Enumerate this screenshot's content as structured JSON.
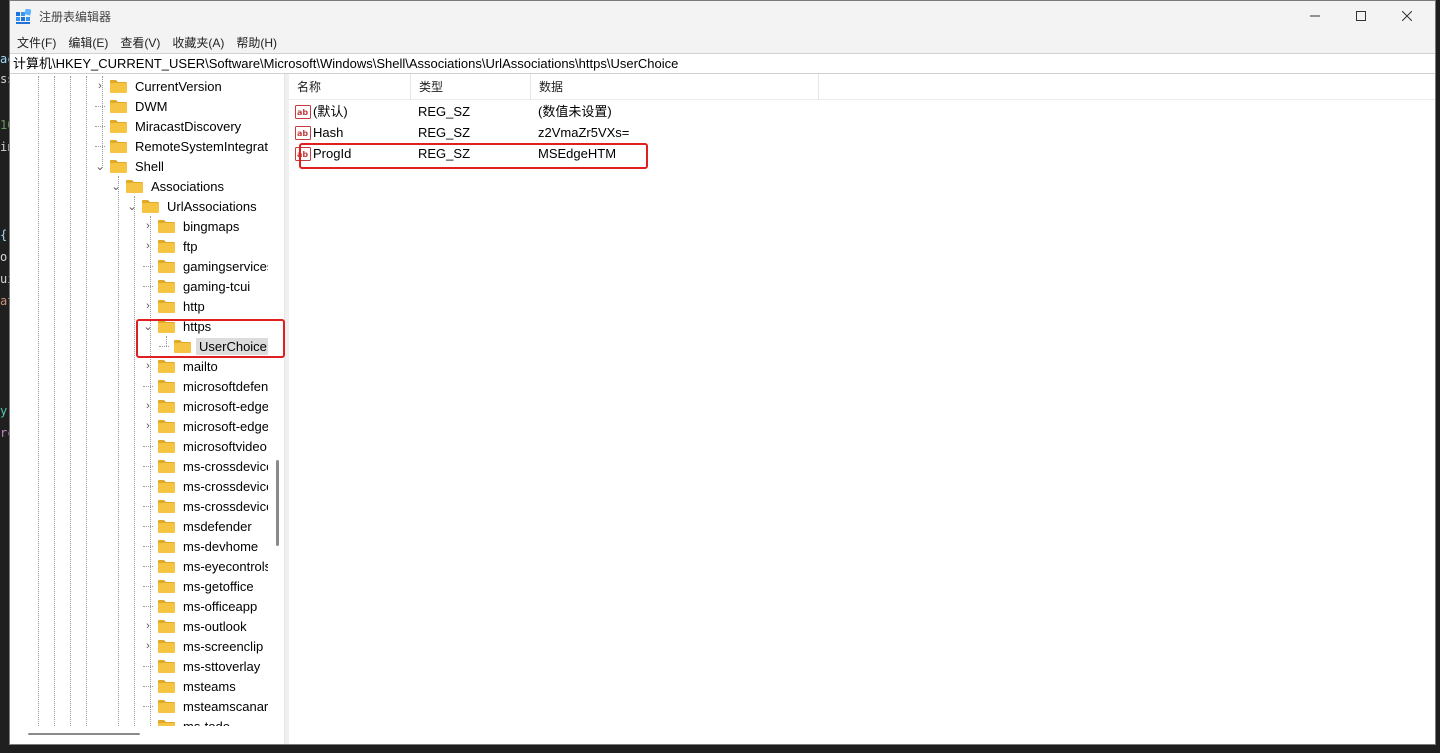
{
  "window": {
    "title": "注册表编辑器",
    "controls": {
      "minimize": "—",
      "maximize": "☐",
      "close": "✕"
    }
  },
  "menu": [
    {
      "label": "文件(F)"
    },
    {
      "label": "编辑(E)"
    },
    {
      "label": "查看(V)"
    },
    {
      "label": "收藏夹(A)"
    },
    {
      "label": "帮助(H)"
    }
  ],
  "address": "计算机\\HKEY_CURRENT_USER\\Software\\Microsoft\\Windows\\Shell\\Associations\\UrlAssociations\\https\\UserChoice",
  "tree": {
    "items": [
      {
        "label": "CurrentVersion",
        "expander": "›"
      },
      {
        "label": "DWM",
        "expander": ""
      },
      {
        "label": "MiracastDiscovery",
        "expander": ""
      },
      {
        "label": "RemoteSystemIntegrati",
        "expander": ""
      },
      {
        "label": "Shell",
        "expander": "⌄"
      },
      {
        "label": "Associations",
        "expander": "⌄"
      },
      {
        "label": "UrlAssociations",
        "expander": "⌄"
      },
      {
        "label": "bingmaps",
        "expander": "›"
      },
      {
        "label": "ftp",
        "expander": "›"
      },
      {
        "label": "gamingservices",
        "expander": ""
      },
      {
        "label": "gaming-tcui",
        "expander": ""
      },
      {
        "label": "http",
        "expander": "›"
      },
      {
        "label": "https",
        "expander": "⌄"
      },
      {
        "label": "UserChoice",
        "expander": ""
      },
      {
        "label": "mailto",
        "expander": "›"
      },
      {
        "label": "microsoftdefen",
        "expander": ""
      },
      {
        "label": "microsoft-edge",
        "expander": "›"
      },
      {
        "label": "microsoft-edge",
        "expander": "›"
      },
      {
        "label": "microsoftvideo",
        "expander": ""
      },
      {
        "label": "ms-crossdevice",
        "expander": ""
      },
      {
        "label": "ms-crossdevice",
        "expander": ""
      },
      {
        "label": "ms-crossdevice",
        "expander": ""
      },
      {
        "label": "msdefender",
        "expander": ""
      },
      {
        "label": "ms-devhome",
        "expander": ""
      },
      {
        "label": "ms-eyecontrols",
        "expander": ""
      },
      {
        "label": "ms-getoffice",
        "expander": ""
      },
      {
        "label": "ms-officeapp",
        "expander": ""
      },
      {
        "label": "ms-outlook",
        "expander": "›"
      },
      {
        "label": "ms-screenclip",
        "expander": "›"
      },
      {
        "label": "ms-sttoverlay",
        "expander": ""
      },
      {
        "label": "msteams",
        "expander": ""
      },
      {
        "label": "msteamscanary",
        "expander": ""
      },
      {
        "label": "ms-todo",
        "expander": ""
      }
    ],
    "selected": "UserChoice"
  },
  "list": {
    "columns": {
      "name": "名称",
      "type": "类型",
      "data": "数据"
    },
    "rows": [
      {
        "name": "(默认)",
        "type": "REG_SZ",
        "data": "(数值未设置)",
        "icon": "string-value-icon"
      },
      {
        "name": "Hash",
        "type": "REG_SZ",
        "data": "z2VmaZr5VXs=",
        "icon": "string-value-icon"
      },
      {
        "name": "ProgId",
        "type": "REG_SZ",
        "data": "MSEdgeHTM",
        "icon": "string-value-icon"
      }
    ]
  },
  "colors": {
    "annotation": "#e02020",
    "folder": "#f5c443",
    "folder_dark": "#e0a92a",
    "selection": "#dcdcdc",
    "titlebar": "#f3f3f3"
  }
}
